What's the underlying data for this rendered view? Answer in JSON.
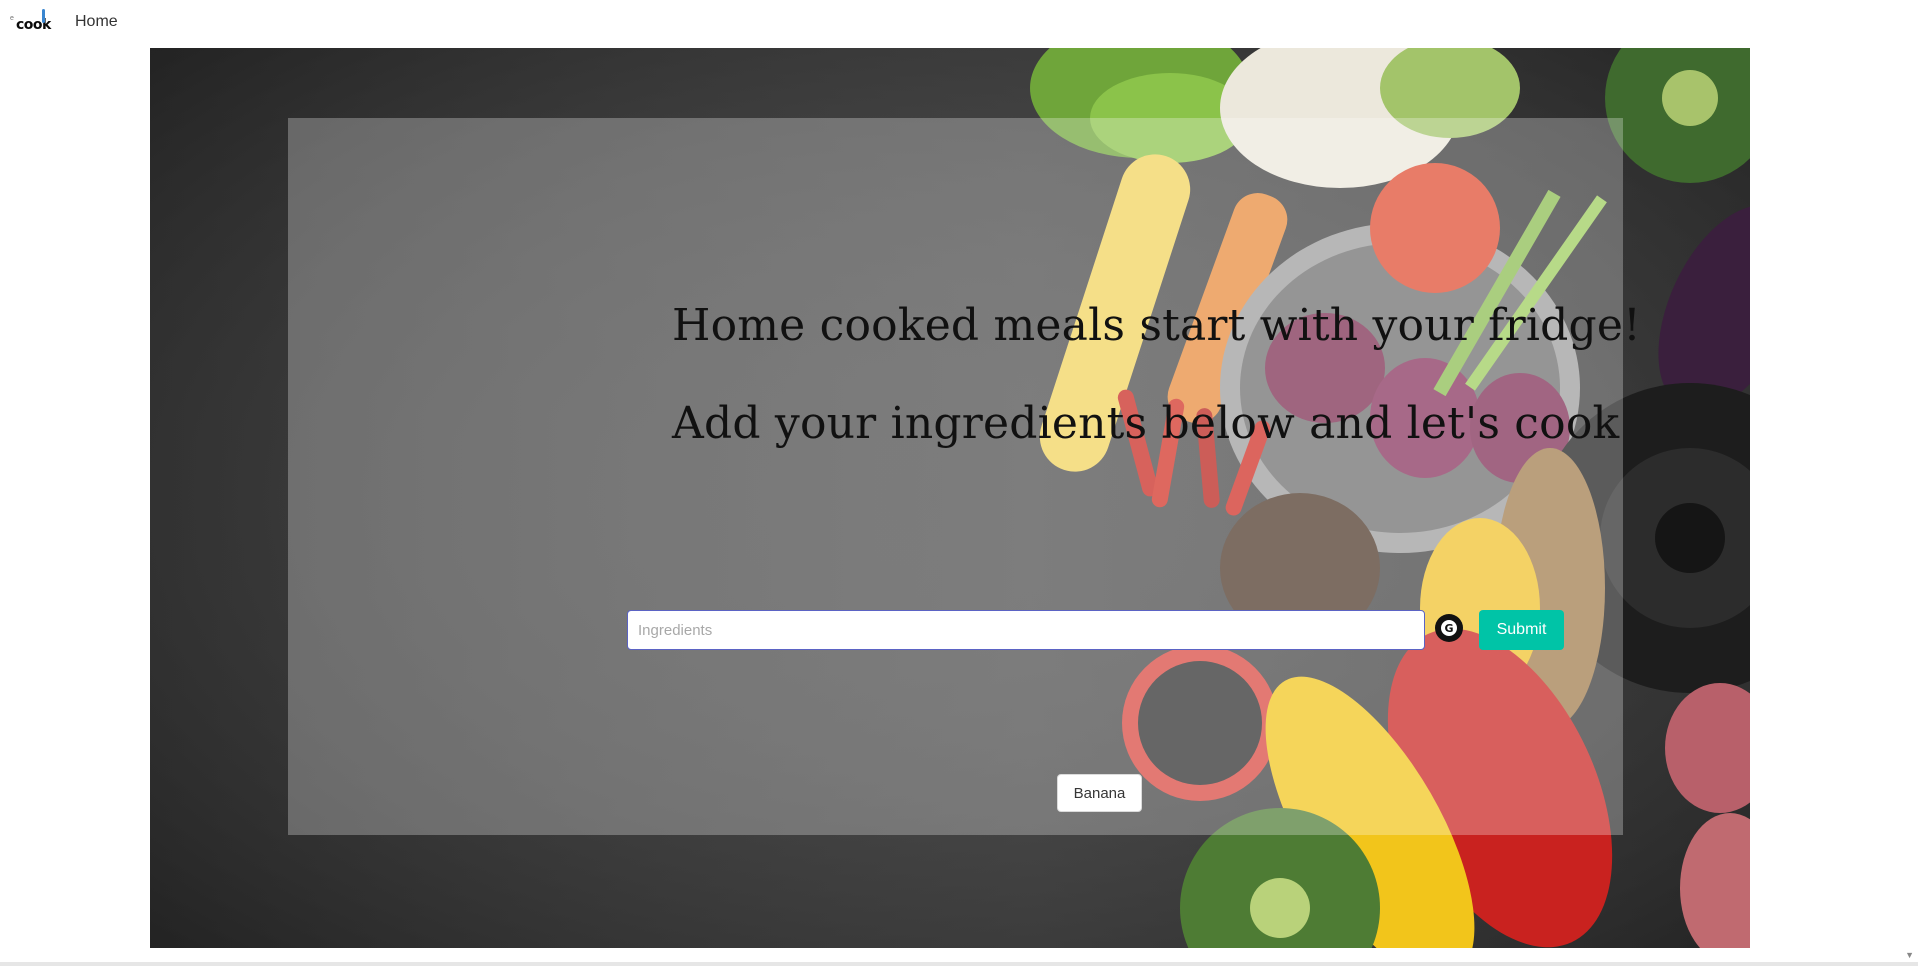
{
  "app": {
    "logo_text": "cook",
    "logo_small_text": "e",
    "nav": {
      "home_label": "Home"
    }
  },
  "hero": {
    "headline": "Home cooked meals start with your fridge!",
    "subheadline": "Add your ingredients below and let's cook",
    "search": {
      "value": "",
      "placeholder": "Ingredients"
    },
    "extension_icon_letter": "G",
    "submit_label": "Submit",
    "ingredients": [
      {
        "label": "Banana"
      }
    ]
  },
  "icons": {
    "logo": "cook-logo-icon",
    "extension": "grammarly-icon",
    "scroll": "scroll-down-arrow-icon"
  },
  "colors": {
    "submit_bg": "#00c4a7",
    "input_border": "#5b63c4",
    "background": "#ffffff",
    "overlay": "rgba(255,255,255,0.28)"
  }
}
